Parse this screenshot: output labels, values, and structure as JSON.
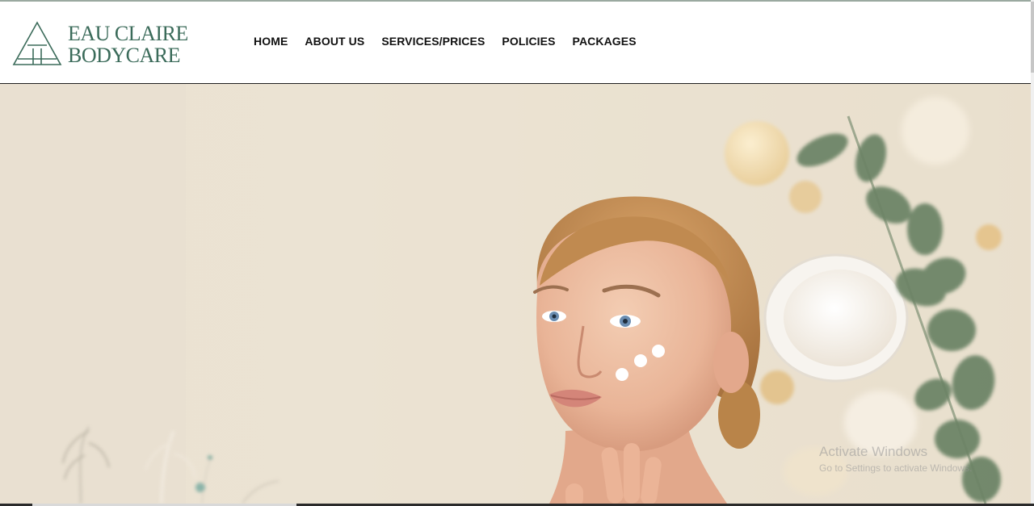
{
  "brand": {
    "line1": "EAU CLAIRE",
    "line2": "BODYCARE",
    "color": "#3b6b5a"
  },
  "nav": {
    "items": [
      {
        "label": "HOME"
      },
      {
        "label": "ABOUT US"
      },
      {
        "label": "SERVICES/PRICES"
      },
      {
        "label": "POLICIES"
      },
      {
        "label": "PACKAGES"
      }
    ]
  },
  "hero": {
    "image": "woman-applying-face-cream-with-spa-products"
  },
  "watermark": {
    "title": "Activate Windows",
    "subtitle": "Go to Settings to activate Windows."
  }
}
